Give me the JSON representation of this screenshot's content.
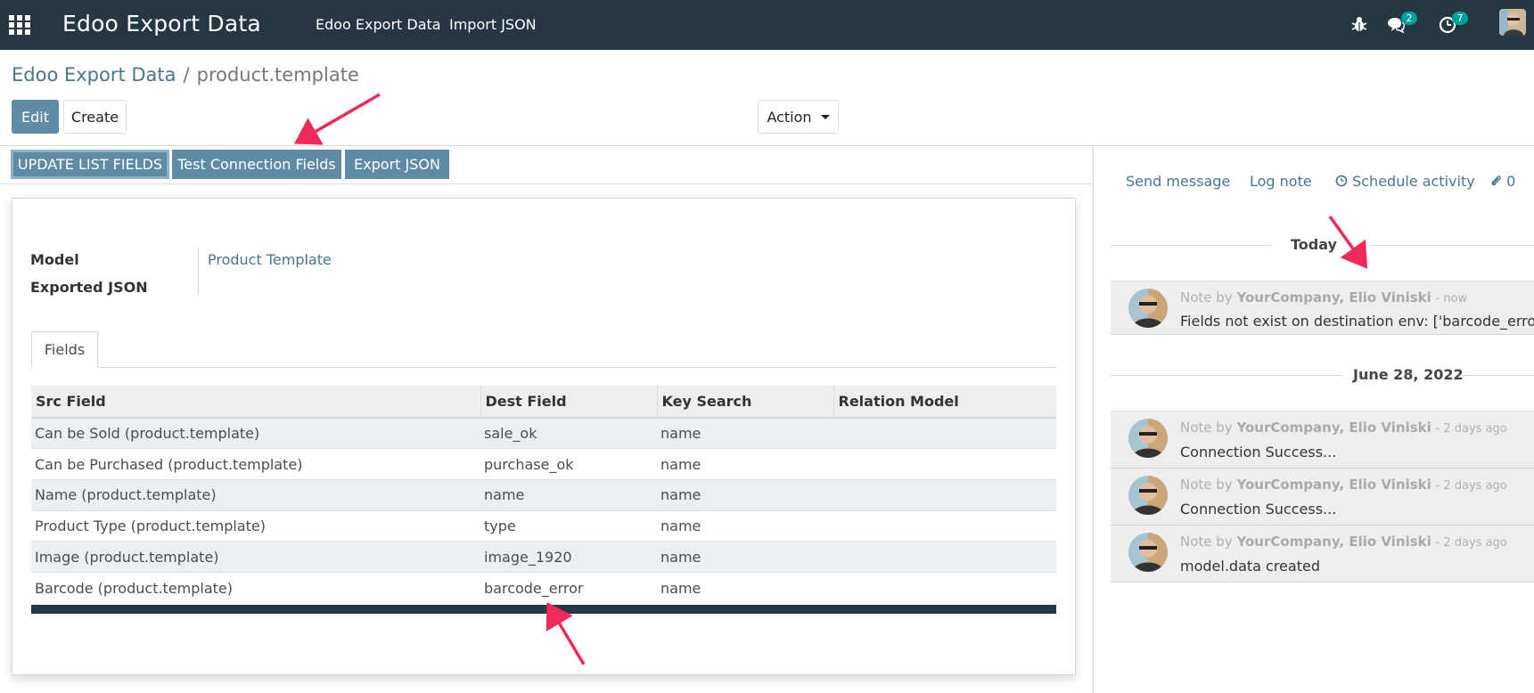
{
  "navbar": {
    "app_title": "Edoo Export Data",
    "menus": [
      "Edoo Export Data",
      "Import JSON"
    ],
    "messages_count": "2",
    "activities_count": "7",
    "bg_color": "#243742"
  },
  "breadcrumb": {
    "parent": "Edoo Export Data",
    "separator": "/",
    "current": "product.template"
  },
  "control_panel": {
    "edit_label": "Edit",
    "create_label": "Create",
    "action_label": "Action"
  },
  "header_buttons": {
    "update_list_fields": "UPDATE LIST FIELDS",
    "test_connection_fields": "Test Connection Fields",
    "export_json": "Export JSON"
  },
  "form": {
    "model_label": "Model",
    "model_value": "Product Template",
    "exported_json_label": "Exported JSON",
    "exported_json_value": ""
  },
  "tabs": {
    "fields": "Fields"
  },
  "fields_table": {
    "columns": [
      "Src Field",
      "Dest Field",
      "Key Search",
      "Relation Model"
    ],
    "rows": [
      {
        "src": "Can be Sold (product.template)",
        "dest": "sale_ok",
        "key": "name",
        "relation": ""
      },
      {
        "src": "Can be Purchased (product.template)",
        "dest": "purchase_ok",
        "key": "name",
        "relation": ""
      },
      {
        "src": "Name (product.template)",
        "dest": "name",
        "key": "name",
        "relation": ""
      },
      {
        "src": "Product Type (product.template)",
        "dest": "type",
        "key": "name",
        "relation": ""
      },
      {
        "src": "Image (product.template)",
        "dest": "image_1920",
        "key": "name",
        "relation": ""
      },
      {
        "src": "Barcode (product.template)",
        "dest": "barcode_error",
        "key": "name",
        "relation": ""
      }
    ]
  },
  "chatter": {
    "send_message": "Send message",
    "log_note": "Log note",
    "schedule_activity": "Schedule activity",
    "attachments_count": "0",
    "groups": [
      {
        "date": "Today",
        "messages": [
          {
            "type": "Note by",
            "author": "YourCompany, Elio Viniski",
            "time": "- now",
            "body": "Fields not exist on destination env: ['barcode_error']"
          }
        ]
      },
      {
        "date": "June 28, 2022",
        "messages": [
          {
            "type": "Note by",
            "author": "YourCompany, Elio Viniski",
            "time": "- 2 days ago",
            "body": "Connection Success..."
          },
          {
            "type": "Note by",
            "author": "YourCompany, Elio Viniski",
            "time": "- 2 days ago",
            "body": "Connection Success..."
          },
          {
            "type": "Note by",
            "author": "YourCompany, Elio Viniski",
            "time": "- 2 days ago",
            "body": "model.data created"
          }
        ]
      }
    ]
  },
  "colors": {
    "primary": "#5f8ba4",
    "link": "#4a7590",
    "annotation_arrow": "#ee2a5a"
  }
}
